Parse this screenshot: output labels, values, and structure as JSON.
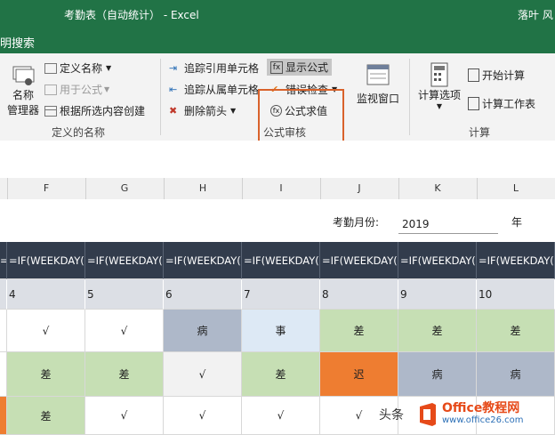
{
  "titlebar": {
    "doc": "考勤表（自动统计） - Excel",
    "user": "落叶 风"
  },
  "tabstrip": {
    "search": "明搜索"
  },
  "ribbon": {
    "names": {
      "name_manager_l1": "名称",
      "name_manager_l2": "管理器",
      "define_name": "定义名称",
      "use_in_formula": "用于公式",
      "create_from_selection": "根据所选内容创建",
      "group": "定义的名称"
    },
    "audit": {
      "trace_precedents": "追踪引用单元格",
      "trace_dependents": "追踪从属单元格",
      "remove_arrows": "删除箭头",
      "show_formulas": "显示公式",
      "error_checking": "错误检查",
      "evaluate_formula": "公式求值",
      "watch_window": "监视窗口",
      "group": "公式审核"
    },
    "calc": {
      "options_l1": "计算选项",
      "calc_now": "开始计算",
      "calc_sheet": "计算工作表",
      "group": "计算"
    }
  },
  "columns": [
    "F",
    "G",
    "H",
    "I",
    "J",
    "K",
    "L"
  ],
  "sheet": {
    "month_label": "考勤月份:",
    "year_value": "2019",
    "year_unit": "年",
    "formula_text": "=IF(WEEKDAY(D",
    "day_numbers": [
      "4",
      "5",
      "6",
      "7",
      "8",
      "9",
      "10"
    ],
    "rows": [
      [
        "√",
        "√",
        "病",
        "事",
        "差",
        "差",
        "差"
      ],
      [
        "差",
        "差",
        "√",
        "差",
        "迟",
        "病",
        "病"
      ],
      [
        "差",
        "√",
        "√",
        "√",
        "√",
        "",
        ""
      ]
    ]
  },
  "colors": {
    "excel_green": "#217346",
    "formula_bg": "#323c4c",
    "highlight_box": "#d9622b",
    "sick": "#aeb8c9",
    "leave": "#dde9f5",
    "business": "#c6dfb4",
    "late": "#ee7d31"
  },
  "watermark": {
    "toutiao": "头条",
    "brand": "Office教程网",
    "url": "www.office26.com"
  }
}
